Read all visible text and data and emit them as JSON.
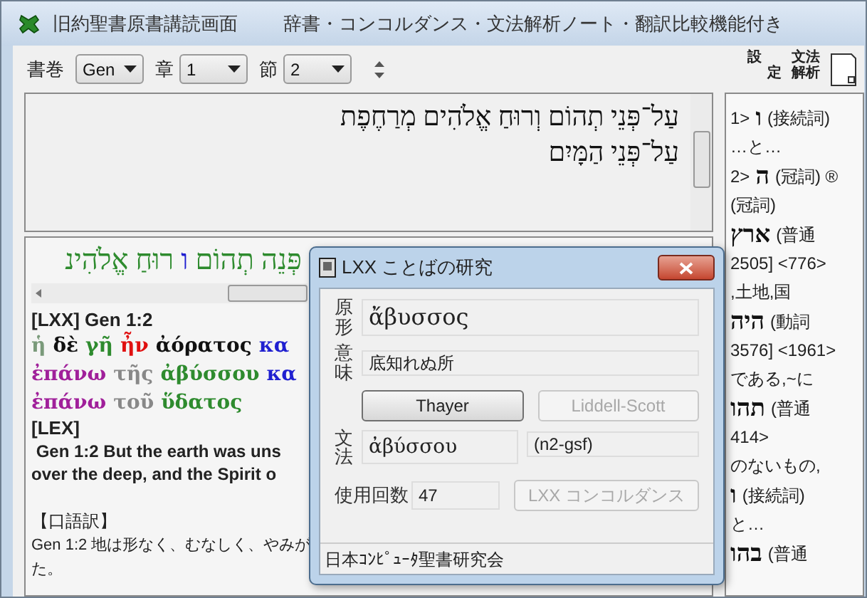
{
  "window": {
    "title": "旧約聖書原書講読画面",
    "subtitle": "辞書・コンコルダンス・文法解析ノート・翻訳比較機能付き"
  },
  "toolbar": {
    "selects": [
      {
        "label": "書巻",
        "value": "Gen"
      },
      {
        "label": "章",
        "value": "1"
      },
      {
        "label": "節",
        "value": "2"
      }
    ],
    "buttons": [
      "設定",
      "文法解析"
    ]
  },
  "hebrew_text": {
    "lines": [
      "עַל־פְּנֵי תְהוֹם וְרוּחַ אֱלֹהִים מְרַחֶפֶת",
      "עַל־פְּנֵי הַמָּיִם"
    ]
  },
  "analysis": {
    "hebrew_words": [
      {
        "text": "פְּנֵה",
        "color": "#2e8b2e"
      },
      {
        "text": "תְהוֹם",
        "color": "#2e8b2e"
      },
      {
        "text": "ו",
        "color": "#1f1fd0"
      },
      {
        "text": "רוּחַ",
        "color": "#2e8b2e"
      },
      {
        "text": "אֱלֹהִינ",
        "color": "#2e8b2e"
      }
    ],
    "lxx_heading": "[LXX] Gen 1:2",
    "greek_lines": [
      [
        {
          "text": "ἡ",
          "color": "#7a9a7a"
        },
        {
          "text": "δὲ",
          "color": "#111111"
        },
        {
          "text": "γῆ",
          "color": "#2e8b2e"
        },
        {
          "text": "ἦν",
          "color": "#e01010"
        },
        {
          "text": "ἀόρατος",
          "color": "#111111"
        },
        {
          "text": "κα",
          "color": "#1f1fd0"
        }
      ],
      [
        {
          "text": "ἐπάνω",
          "color": "#a0209a"
        },
        {
          "text": "τῆς",
          "color": "#888888"
        },
        {
          "text": "ἀβύσσου",
          "color": "#2e8b2e"
        },
        {
          "text": "κα",
          "color": "#1f1fd0"
        }
      ],
      [
        {
          "text": "ἐπάνω",
          "color": "#a0209a"
        },
        {
          "text": "τοῦ",
          "color": "#888888"
        },
        {
          "text": "ὕδατος",
          "color": "#2e8b2e"
        }
      ]
    ],
    "lex_heading": "[LEX]",
    "lex_lines": [
      " Gen 1:2 But the earth was uns",
      "over the deep, and the Spirit o"
    ],
    "colloquial_heading": "【口語訳】",
    "colloquial_lines": [
      "Gen 1:2 地は形なく、むなしく、やみが",
      "た。"
    ]
  },
  "dictionary": [
    {
      "kind": "head",
      "num": "1>",
      "word": "ו",
      "pos": "(接続詞)"
    },
    {
      "kind": "text",
      "text": "…と…"
    },
    {
      "kind": "head",
      "num": "2>",
      "word": "ה",
      "pos": "(冠詞) ®"
    },
    {
      "kind": "text",
      "text": "(冠詞)"
    },
    {
      "kind": "head",
      "word": "ארץ",
      "pos": "(普通"
    },
    {
      "kind": "text",
      "text": "2505] <776>"
    },
    {
      "kind": "text",
      "text": ",土地,国"
    },
    {
      "kind": "head",
      "word": "היה",
      "pos": "(動詞"
    },
    {
      "kind": "text",
      "text": "3576] <1961>"
    },
    {
      "kind": "text",
      "text": "である,~に"
    },
    {
      "kind": "head",
      "word": "תהו",
      "pos": "(普通"
    },
    {
      "kind": "text",
      "text": "414>"
    },
    {
      "kind": "text",
      "text": "のないもの,"
    },
    {
      "kind": "head",
      "word": "ו",
      "pos": "(接続詞)"
    },
    {
      "kind": "text",
      "text": "と…"
    },
    {
      "kind": "head",
      "word": "בהו",
      "pos": "(普通"
    }
  ],
  "dialog": {
    "title": "LXX ことばの研究",
    "lemma_label": "原形",
    "lemma": "ἄβυσσος",
    "meaning_label": "意味",
    "meaning": "底知れぬ所",
    "buttons": [
      {
        "label": "Thayer",
        "disabled": false
      },
      {
        "label": "Liddell-Scott",
        "disabled": true
      }
    ],
    "grammar_label": "文法",
    "form": "ἀβύσσου",
    "parse": "(n2-gsf)",
    "count_label": "使用回数",
    "count": "47",
    "concordance": {
      "label": "LXX コンコルダンス",
      "disabled": true
    },
    "status": "日本ｺﾝﾋﾟｭｰﾀ聖書研究会"
  }
}
